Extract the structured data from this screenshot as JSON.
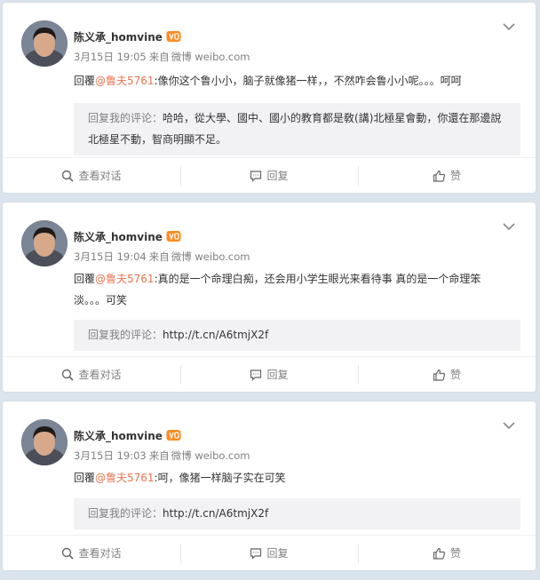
{
  "user": {
    "name": "陈义承_homvine"
  },
  "labels": {
    "from": "来自",
    "view_conversation": "查看对话",
    "reply": "回复",
    "like": "赞",
    "reply_prefix": "回覆",
    "quote_label": "回复我的评论："
  },
  "posts": [
    {
      "time": "3月15日 19:05",
      "client": "微博 weibo.com",
      "mention": "@鲁夫5761",
      "text": ":像你这个鲁小小，脑子就像猪一样，，不然咋会鲁小小呢。。。呵呵",
      "quote_text": "哈哈，從大學、國中、國小的教育都是敎(講)北極星會動，你還在那邊說北極星不動，智商明顯不足。"
    },
    {
      "time": "3月15日 19:04",
      "client": "微博 weibo.com",
      "mention": "@鲁夫5761",
      "text": ":真的是一个命理白痴，还会用小学生眼光来看待事  真的是一个命理笨淡。。。可笑",
      "quote_text": "http://t.cn/A6tmjX2f"
    },
    {
      "time": "3月15日 19:03",
      "client": "微博 weibo.com",
      "mention": "@鲁夫5761",
      "text": ":呵，像猪一样脑子实在可笑",
      "quote_text": "http://t.cn/A6tmjX2f"
    }
  ],
  "colors": {
    "mention": "#eb7350",
    "page_bg": "#dbe3ec",
    "quote_bg": "#f2f2f5",
    "meta_gray": "#808080"
  },
  "icons": [
    "chevron-down-icon",
    "avatar",
    "vip-badge-icon",
    "search-icon",
    "comment-icon",
    "thumbs-up-icon"
  ]
}
